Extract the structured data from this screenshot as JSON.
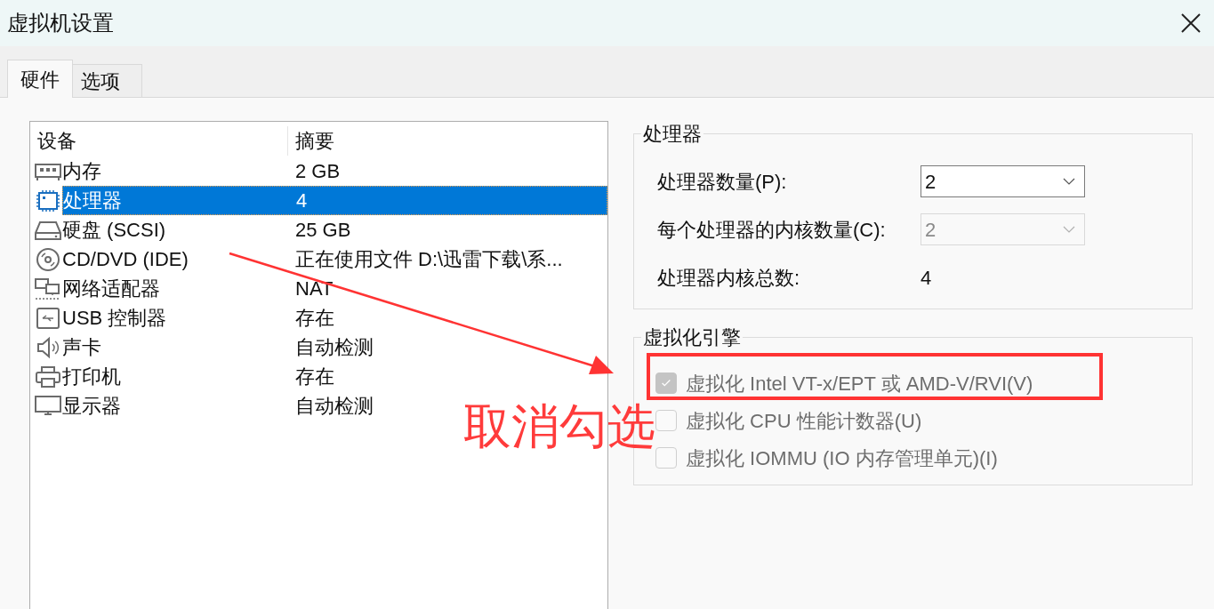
{
  "window": {
    "title": "虚拟机设置"
  },
  "tabs": [
    {
      "label": "硬件",
      "selected": true
    },
    {
      "label": "选项",
      "selected": false
    }
  ],
  "device_list": {
    "columns": [
      "设备",
      "摘要"
    ],
    "rows": [
      {
        "device": "内存",
        "summary": "2 GB",
        "selected": false
      },
      {
        "device": "处理器",
        "summary": "4",
        "selected": true
      },
      {
        "device": "硬盘 (SCSI)",
        "summary": "25 GB",
        "selected": false
      },
      {
        "device": "CD/DVD (IDE)",
        "summary": "正在使用文件 D:\\迅雷下载\\系...",
        "selected": false
      },
      {
        "device": "网络适配器",
        "summary": "NAT",
        "selected": false
      },
      {
        "device": "USB 控制器",
        "summary": "存在",
        "selected": false
      },
      {
        "device": "声卡",
        "summary": "自动检测",
        "selected": false
      },
      {
        "device": "打印机",
        "summary": "存在",
        "selected": false
      },
      {
        "device": "显示器",
        "summary": "自动检测",
        "selected": false
      }
    ]
  },
  "processors": {
    "title": "处理器",
    "fields": [
      {
        "kind": "dropdown",
        "label": "处理器数量(P):",
        "value": "2",
        "disabled": false
      },
      {
        "kind": "dropdown",
        "label": "每个处理器的内核数量(C):",
        "value": "2",
        "disabled": true
      },
      {
        "kind": "readout",
        "label": "处理器内核总数:",
        "value": "4"
      }
    ]
  },
  "virtualization_engine": {
    "title": "虚拟化引擎",
    "options": [
      {
        "label": "虚拟化 Intel VT-x/EPT 或 AMD-V/RVI(V)",
        "checked": true,
        "disabled": true
      },
      {
        "label": "虚拟化 CPU 性能计数器(U)",
        "checked": false,
        "disabled": true
      },
      {
        "label": "虚拟化 IOMMU (IO 内存管理单元)(I)",
        "checked": false,
        "disabled": true
      }
    ]
  },
  "annotation": {
    "text": "取消勾选"
  }
}
